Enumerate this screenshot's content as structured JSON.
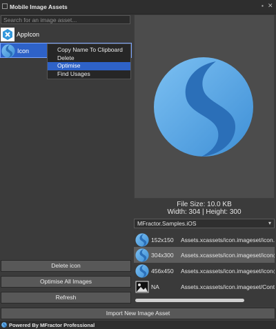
{
  "window": {
    "title": "Mobile Image Assets"
  },
  "search": {
    "placeholder": "Search for an image asset..."
  },
  "assets": [
    {
      "label": "AppIcon",
      "icon": "xamarin-logo-icon"
    },
    {
      "label": "Icon",
      "icon": "sphere-logo-icon",
      "selected": true
    }
  ],
  "context_menu": {
    "items": [
      {
        "label": "Copy Name To Clipboard"
      },
      {
        "label": "Delete"
      },
      {
        "label": "Optimise",
        "highlighted": true
      },
      {
        "label": "Find Usages"
      }
    ]
  },
  "buttons": {
    "delete": "Delete icon",
    "optimise_all": "Optimise All Images",
    "refresh": "Refresh",
    "import": "Import New Image Asset"
  },
  "preview": {
    "file_size": "File Size: 10.0 KB",
    "dimensions": "Width: 304 | Height: 300"
  },
  "project": {
    "selected": "MFractor.Samples.iOS"
  },
  "variants": [
    {
      "size": "152x150",
      "path": "Assets.xcassets/icon.imageset/icon.p",
      "icon": "sphere-logo-icon"
    },
    {
      "size": "304x300",
      "path": "Assets.xcassets/icon.imageset/icon@",
      "icon": "sphere-logo-icon",
      "selected": true
    },
    {
      "size": "456x450",
      "path": "Assets.xcassets/icon.imageset/icon@",
      "icon": "sphere-logo-icon"
    },
    {
      "size": "NA",
      "path": "Assets.xcassets/icon.imageset/Conte",
      "icon": "image-placeholder-icon"
    }
  ],
  "status": {
    "text": "Powered By MFractor Professional"
  },
  "colors": {
    "accent": "#2e62c8",
    "background": "#3b3b3b",
    "logo_light": "#5aa9e6",
    "logo_dark": "#1f5fa8"
  }
}
